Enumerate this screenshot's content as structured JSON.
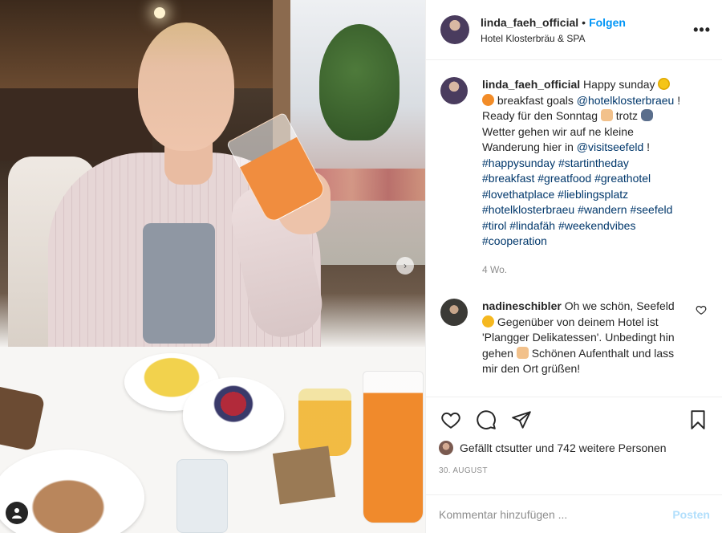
{
  "header": {
    "username": "linda_faeh_official",
    "separator": "•",
    "follow_label": "Folgen",
    "location": "Hotel Klosterbräu & SPA",
    "more_icon": "more-horizontal-icon"
  },
  "caption": {
    "username": "linda_faeh_official",
    "part1": "Happy sunday",
    "part2": "breakfast goals",
    "mention1": "@hotelklosterbraeu",
    "part3": "! Ready für den Sonntag",
    "part4": "trotz",
    "part5": "Wetter gehen wir auf ne kleine Wanderung hier in",
    "mention2": "@visitseefeld",
    "part6": "!",
    "hashtags": "#happysunday #startintheday #breakfast #greatfood #greathotel #lovethatplace #lieblingsplatz #hotelklosterbraeu #wandern #seefeld #tirol #lindafäh #weekendvibes #cooperation",
    "timestamp": "4 Wo."
  },
  "comment": {
    "username": "nadineschibler",
    "part1": "Oh we schön, Seefeld",
    "part2": "Gegenüber von deinem Hotel ist 'Plangger Delikatessen'. Unbedingt hin gehen",
    "part3": "Schönen Aufenthalt und lass mir den Ort grüßen!"
  },
  "actions": {
    "likes_text": "Gefällt ctsutter und 742 weitere Personen",
    "date": "30. AUGUST"
  },
  "add_comment": {
    "placeholder": "Kommentar hinzufügen ...",
    "post_label": "Posten"
  },
  "colors": {
    "accent": "#0095f6",
    "post_disabled": "#b2dffc",
    "muted": "#8e8e8e",
    "text": "#262626"
  }
}
